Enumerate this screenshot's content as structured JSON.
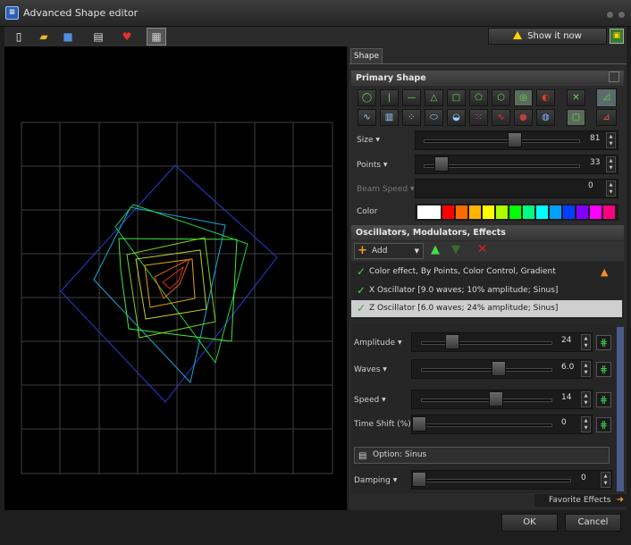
{
  "window": {
    "title": "Advanced Shape editor",
    "app_icon": "shape-editor-icon"
  },
  "toolbar": {
    "icons": [
      "new-file-icon",
      "open-folder-icon",
      "save-icon",
      "clapper-icon",
      "heart-icon",
      "grid-toggle-icon"
    ],
    "show_label": "Show it now",
    "show_icon": "warning-icon",
    "preview_icon": "preview-icon"
  },
  "tabs": {
    "shape": "Shape"
  },
  "primary": {
    "header": "Primary Shape",
    "shape_icons": [
      "circle-icon",
      "vertical-line-icon",
      "horizontal-line-icon",
      "triangle-icon",
      "square-icon",
      "pentagon-icon",
      "hexagon-icon",
      "ring-icon",
      "swirl-icon",
      "cross-icon",
      "wave-icon",
      "bars-icon",
      "dots-icon",
      "ellipse-icon",
      "lens-icon",
      "dot-grid-icon",
      "sine-icon",
      "sphere-icon",
      "globe-icon",
      "frame-icon",
      "chart-icon"
    ],
    "size_label": "Size",
    "size_value": "81",
    "size_level": 0.55,
    "points_label": "Points",
    "points_value": "33",
    "points_level": 0.08,
    "beam_label": "Beam Speed",
    "beam_value": "0",
    "color_label": "Color",
    "colors": [
      "#ffffff",
      "#ff0000",
      "#ff6a00",
      "#ffb400",
      "#ffff00",
      "#aaff00",
      "#00ff00",
      "#00ff80",
      "#00ffff",
      "#00a0ff",
      "#0040ff",
      "#8000ff",
      "#ff00ff",
      "#ff0080"
    ]
  },
  "osc": {
    "header": "Oscillators, Modulators, Effects",
    "add_label": "Add",
    "items": [
      "Color effect, By Points, Color Control, Gradient",
      "X Oscillator [9.0 waves; 10% amplitude; Sinus]",
      "Z Oscillator [6.0 waves; 24% amplitude; Sinus]"
    ],
    "amp_label": "Amplitude",
    "amp_value": "24",
    "amp_level": 0.2,
    "waves_label": "Waves",
    "waves_value": "6.0",
    "waves_level": 0.55,
    "speed_label": "Speed",
    "speed_value": "14",
    "speed_level": 0.53,
    "shift_label": "Time Shift (%)",
    "shift_value": "0",
    "shift_level": 0.0,
    "option_label": "Option: Sinus",
    "damp_label": "Damping",
    "damp_value": "0",
    "damp_level": 0.0
  },
  "favorites": "Favorite Effects",
  "footer": {
    "ok": "OK",
    "cancel": "Cancel"
  }
}
